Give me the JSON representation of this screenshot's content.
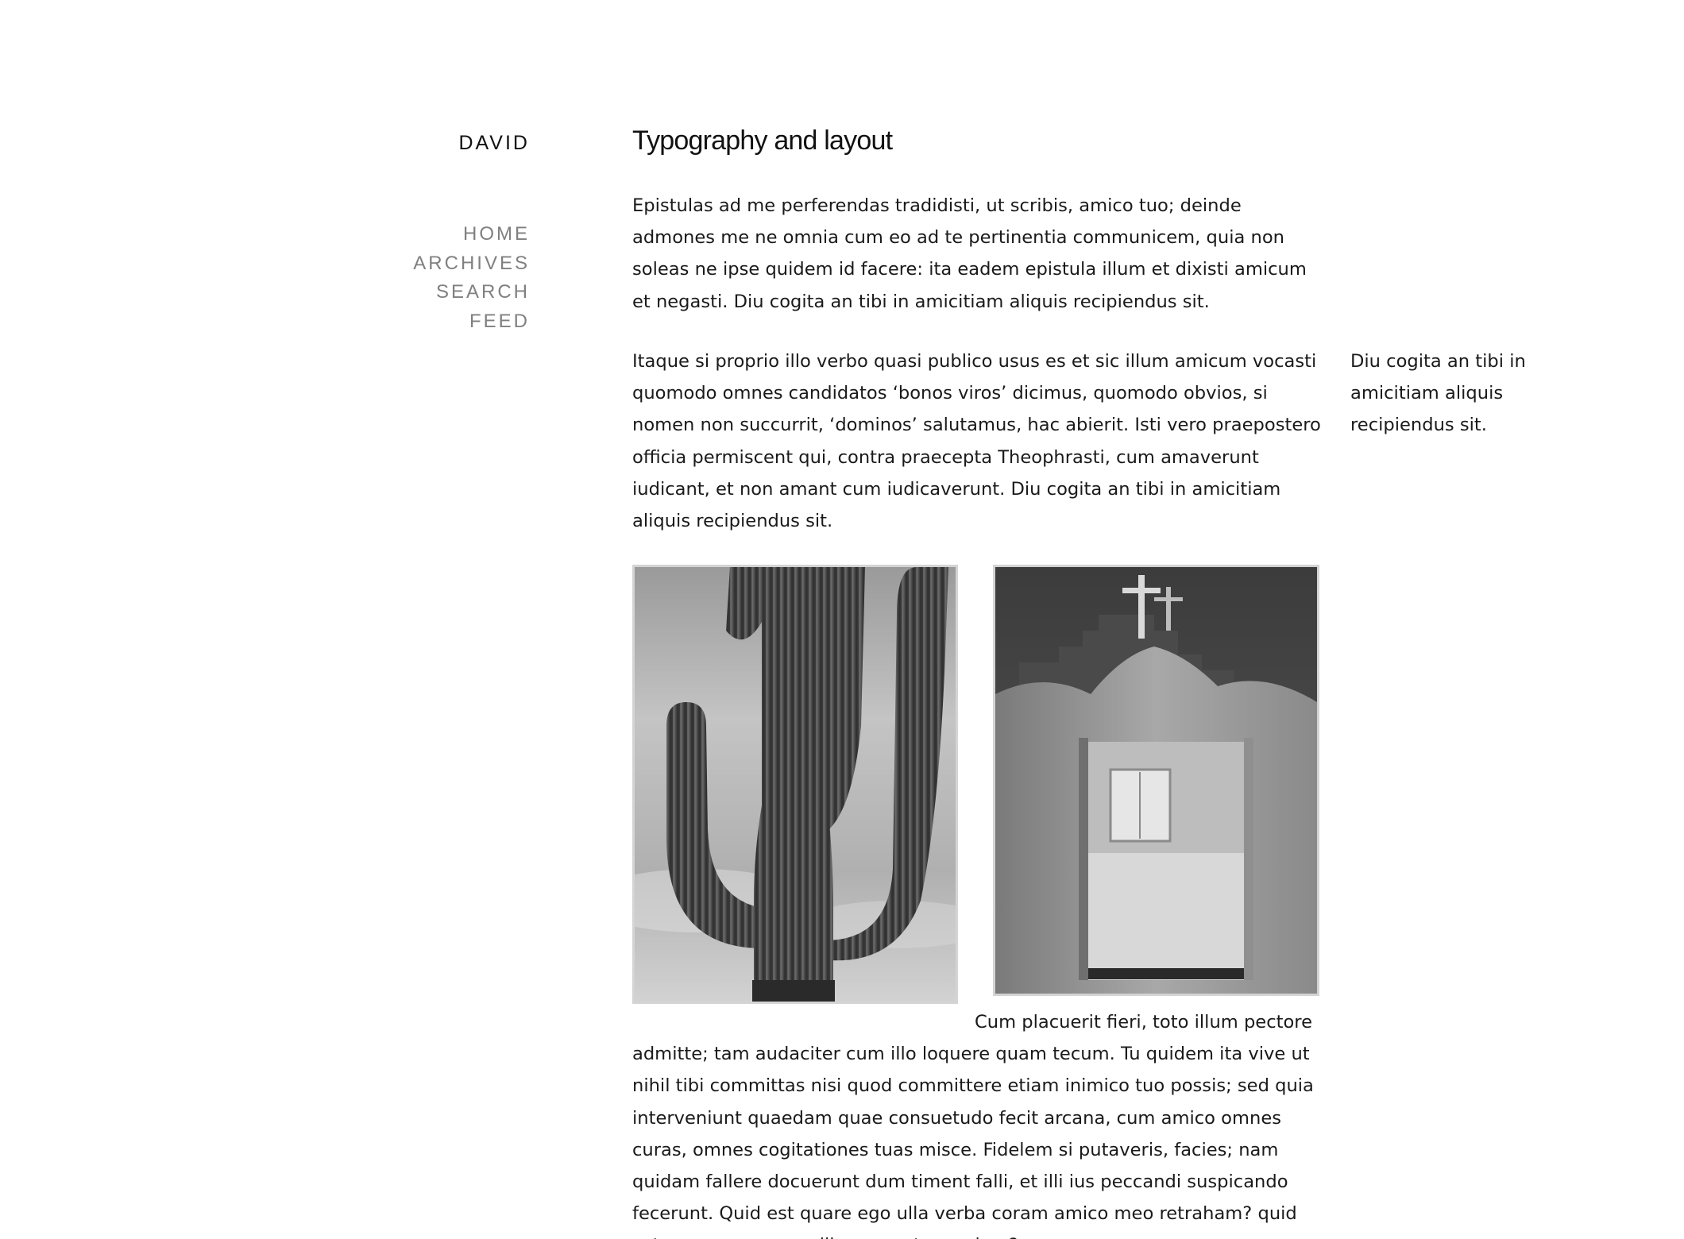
{
  "site": {
    "title": "DAVID"
  },
  "nav": {
    "items": [
      {
        "label": "HOME"
      },
      {
        "label": "ARCHIVES"
      },
      {
        "label": "SEARCH"
      },
      {
        "label": "FEED"
      }
    ]
  },
  "article": {
    "title": "Typography and layout",
    "paragraph_1": "Epistulas ad me perferendas tradidisti, ut scribis, amico tuo; deinde admones me ne omnia cum eo ad te pertinentia communicem, quia non soleas ne ipse quidem id facere: ita eadem epistula illum et dixisti amicum et negasti. Diu cogita an tibi in amicitiam aliquis recipiendus sit.",
    "paragraph_2": "Itaque si proprio illo verbo quasi publico usus es et sic illum amicum vocasti quomodo omnes candidatos ‘bonos viros’ dicimus, quomodo obvios, si nomen non succurrit, ‘dominos’ salutamus, hac abierit. Isti vero praepostero officia permiscent qui, contra praecepta Theophrasti, cum amaverunt iudicant, et non amant cum iudicaverunt. Diu cogita an tibi in amicitiam aliquis recipiendus sit.",
    "sidenote": "Diu cogita an tibi in amicitiam aliquis recipiendus sit.",
    "paragraph_3_lead": "Cum placuerit fieri, toto illum pectore",
    "paragraph_3_rest": "admitte; tam audaciter cum illo loquere quam tecum. Tu quidem ita vive ut nihil tibi committas nisi quod committere etiam inimico tuo possis; sed quia interveniunt quaedam quae consuetudo fecit arcana, cum amico omnes curas, omnes cogitationes tuas misce. Fidelem si putaveris, facies; nam quidam fallere docuerunt dum timent falli, et illi ius peccandi suspicando fecerunt. Quid est quare ego ulla verba coram amico meo retraham? quid est quare me coram illo non putem solum?"
  },
  "figures": [
    {
      "subject": "saguaro-cactus-photo"
    },
    {
      "subject": "adobe-church-gate-photo"
    }
  ],
  "colors": {
    "background": "#ffffff",
    "text": "#1a1a1a",
    "nav": "#808080",
    "image_border": "#d4d4d4"
  }
}
